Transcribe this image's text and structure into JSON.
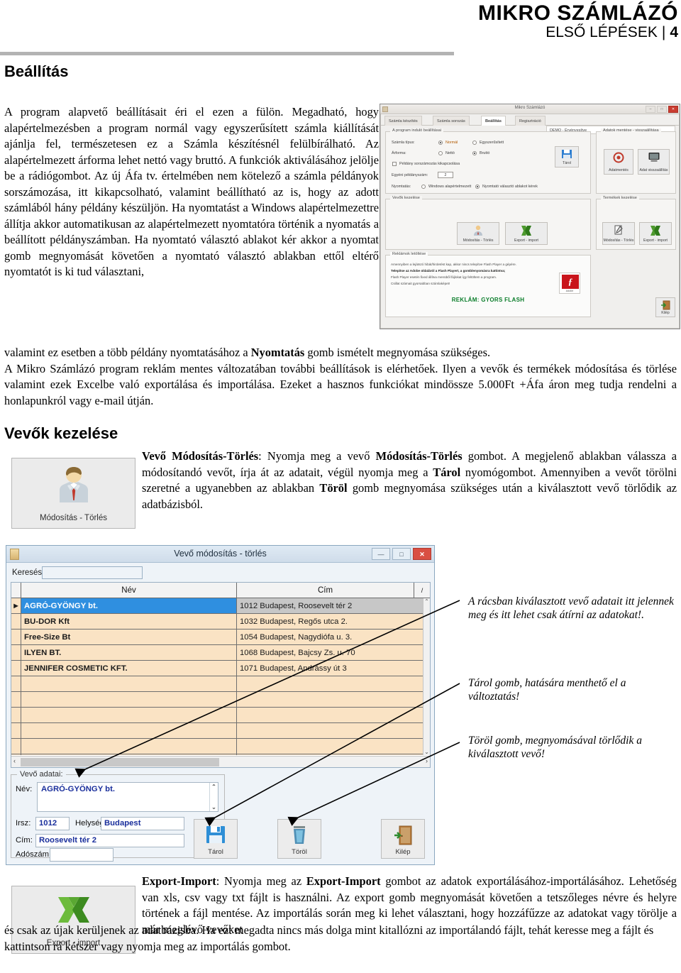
{
  "header": {
    "brand": "MIKRO SZÁMLÁZÓ",
    "subtitle": "ELSŐ LÉPÉSEK",
    "separator": "|",
    "page_number": "4"
  },
  "sections": {
    "beallitas_heading": "Beállítás",
    "vevok_heading": "Vevők kezelése"
  },
  "intro_paragraph": "A program alapvető beállításait éri el ezen a fülön. Megadható, hogy alapértelmezésben a program normál vagy egyszerűsített számla kiállítását ajánlja fel, természetesen ez a Számla készítésnél felülbírálható. Az alapértelmezett árforma lehet nettó vagy bruttó. A funkciók aktiválásához jelölje be a rádiógombot. Az új Áfa tv. értelmében nem kötelező a számla példányok sorszámozása, itt kikapcsolható, valamint beállítható az is, hogy az adott számlából hány példány készüljön. Ha nyomtatást a Windows alapértelmezettre állítja akkor automatikusan az alapértelmezett nyomtatóra történik a nyomatás a beállított példányszámban. Ha nyomtató választó ablakot kér akkor a nyomtat gomb megnyomását követően a nyomtató választó ablakban ettől eltérő nyomtatót is ki tud választani,",
  "wide_paragraph_1_pre": "valamint ez esetben a több példány nyomtatásához a ",
  "wide_paragraph_1_bold": "Nyomtatás",
  "wide_paragraph_1_post": " gomb ismételt megnyomása szükséges.",
  "wide_paragraph_2": "A Mikro Számlázó program reklám mentes változatában további beállítások is elérhetőek. Ilyen a vevők és termékek módosítása és törlése valamint ezek Excelbe való exportálása és importálása. Ezeket a hasznos funkciókat mindössze 5.000Ft +Áfa áron meg tudja rendelni a honlapunkról vagy e-mail útján.",
  "vevo_description": {
    "b1": "Vevő Módosítás-Törlés",
    "t1": ": Nyomja meg a vevő ",
    "b2": "Módosítás-Törlés",
    "t2": "  gombot. A megjelenő ablakban válassza  a módosítandó vevőt, írja át az adatait, végül nyomja meg a ",
    "b3": "Tárol",
    "t3": " nyomógombot. Amennyiben a vevőt törölni szeretné a ugyanebben az ablakban ",
    "b4": "Töröl",
    "t4": " gomb megnyomása szükséges után a kiválasztott vevő törlődik az adatbázisból."
  },
  "export_description": {
    "b1": "Export-Import",
    "t1": ": Nyomja meg az ",
    "b2": "Export-Import",
    "t2": " gombot az adatok exportálásához-importálásához. Lehetőség van xls, csv vagy txt fájlt is használni. Az export gomb megnyomását követően a tetszőleges névre és helyre történek a fájl mentése. Az importálás során meg ki lehet választani, hogy hozzáfűzze az adatokat vagy törölje a már meglévő vevőket",
    "tail": "és csak az újak kerüljenek az adatbázisba. Ha ezt megadta nincs más dolga mint kitallózni az importálandó fájlt, tehát keresse meg a fájlt és kattintson rá kétszer vagy nyomja meg az importálás gombot."
  },
  "buttons": {
    "modositas_torles": "Módosítás - Törlés",
    "export_import": "Export - import"
  },
  "callouts": {
    "grid": "A rácsban kiválasztott vevő adatait itt jelennek meg és itt lehet csak átírni az adatokat!.",
    "tarol": "Tárol gomb, hatására menthető el a változtatás!",
    "torol": "Töröl gomb, megnyomásával törlődik a kiválasztott vevő!"
  },
  "appshot": {
    "window_title": "Mikro Számlázó",
    "tabs": [
      {
        "label": "Számla készítés",
        "active": false
      },
      {
        "label": "Számla sorozás",
        "active": false
      },
      {
        "label": "Beállítás",
        "active": true
      },
      {
        "label": "Regisztráció",
        "active": false
      }
    ],
    "reg_status": "DEMO - Érvényesítve",
    "groups": {
      "program_settings": "A program induló beállításai",
      "backup": "Adatok mentése - visszaállítása",
      "customers": "Vevők kezelése",
      "products": "Termékek kezelése",
      "ad": "Reklámok letöltése"
    },
    "labels": {
      "szamla_tipus": "Számla típus:",
      "arforma": "Árforma:",
      "peldany_sorszam_kikapcs": "Példány sorszámozás kikapcsolása",
      "peldanyszam": "Egyéni példányszám:",
      "nyomtatas": "Nyomtatás:"
    },
    "options": {
      "normal": "Normál",
      "egyszerusitett": "Egyszerűsített",
      "netto": "Nettó",
      "brutto": "Bruttó",
      "windows_alap": "Windows alapértelmezett",
      "nyomtato_valaszto": "Nyomtató választó ablakot kérek"
    },
    "peldanyszam_value": "2",
    "btn_tarol": "Tárol",
    "btn_adatmentes": "Adatmentés",
    "btn_adat_visszaallitas": "Adat visszaállítás",
    "btn_modositas_torles": "Módosítás - Törlés",
    "btn_export_import": "Export - import",
    "btn_kilep": "Kilép",
    "ad_lines": [
      "Amennyiben a lejátszó hibát/hirdetést kap, akkor nincs telepítve Flash Player a gépére.",
      "Telepítse az Adobe oldaláról a Flash Playert, a gomblenyomásra kattintva;",
      "Flash Player esetén fixed állítva menüből fájlokat így feltöltem a program.",
      "Csillat számait gyorsabban számlaképet!"
    ],
    "ad_tagline": "REKLÁM: GYORS FLASH",
    "flash_label": "Adobe"
  },
  "dialog": {
    "title": "Vevő módosítás - törlés",
    "search_label": "Keresés:",
    "search_value": "",
    "min_btn": "—",
    "max_btn": "□",
    "close_btn": "✕",
    "columns": [
      "Név",
      "Cím",
      "/"
    ],
    "rows": [
      {
        "marker": "▶",
        "nev": "AGRÓ-GYÖNGY bt.",
        "cim": "1012 Budapest, Roosevelt tér 2",
        "selected": true
      },
      {
        "marker": "",
        "nev": "BU-DOR Kft",
        "cim": "1032 Budapest, Regős utca 2.",
        "selected": false
      },
      {
        "marker": "",
        "nev": "Free-Size Bt",
        "cim": "1054 Budapest, Nagydiófa u. 3.",
        "selected": false
      },
      {
        "marker": "",
        "nev": "ILYEN BT.",
        "cim": "1068 Budapest, Bajcsy Zs. u.  70",
        "selected": false
      },
      {
        "marker": "",
        "nev": "JENNIFER COSMETIC KFT.",
        "cim": "1071 Budapest, Andrássy út 3",
        "selected": false
      },
      {
        "marker": "",
        "nev": "",
        "cim": "",
        "selected": false
      },
      {
        "marker": "",
        "nev": "",
        "cim": "",
        "selected": false
      },
      {
        "marker": "",
        "nev": "",
        "cim": "",
        "selected": false
      },
      {
        "marker": "",
        "nev": "",
        "cim": "",
        "selected": false
      },
      {
        "marker": "",
        "nev": "",
        "cim": "",
        "selected": false
      }
    ],
    "form": {
      "legend": "Vevő adatai:",
      "nev_label": "Név:",
      "nev_value": "AGRÓ-GYÖNGY bt.",
      "irsz_label": "Irsz:",
      "irsz_value": "1012",
      "helyseg_label": "Helység:",
      "helyseg_value": "Budapest",
      "cim_label": "Cím:",
      "cim_value": "Roosevelt tér 2",
      "adoszam_label": "Adószám:",
      "adoszam_value": ""
    },
    "actions": {
      "tarol": "Tárol",
      "torol": "Töröl",
      "kilep": "Kilép"
    }
  },
  "colors": {
    "rule": "#b3b3b3",
    "grid_row": "#fae3c4",
    "grid_selected": "#2f8fe0",
    "dialog_chrome": "#cfdcea",
    "excel_green": "#4e9a2f",
    "ad_green": "#0a7d2a",
    "flash_red": "#c9141b",
    "field_text": "#1a2f9c"
  }
}
